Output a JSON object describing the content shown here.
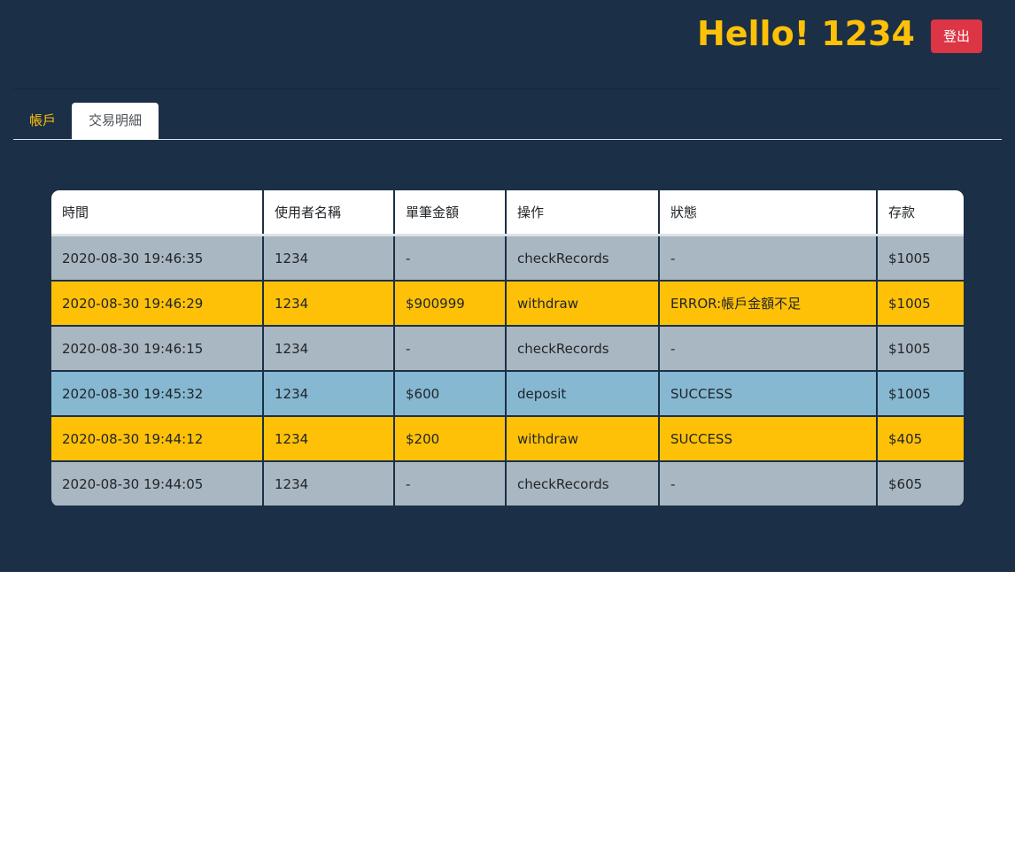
{
  "header": {
    "greeting": "Hello! 1234",
    "logout_label": "登出"
  },
  "tabs": [
    {
      "label": "帳戶",
      "active": false
    },
    {
      "label": "交易明細",
      "active": true
    }
  ],
  "table": {
    "columns": [
      "時間",
      "使用者名稱",
      "單筆金額",
      "操作",
      "狀態",
      "存款"
    ],
    "rows": [
      {
        "time": "2020-08-30 19:46:35",
        "user": "1234",
        "amount": "-",
        "action": "checkRecords",
        "status": "-",
        "balance": "$1005",
        "color": "gray"
      },
      {
        "time": "2020-08-30 19:46:29",
        "user": "1234",
        "amount": "$900999",
        "action": "withdraw",
        "status": "ERROR:帳戶金額不足",
        "balance": "$1005",
        "color": "yellow"
      },
      {
        "time": "2020-08-30 19:46:15",
        "user": "1234",
        "amount": "-",
        "action": "checkRecords",
        "status": "-",
        "balance": "$1005",
        "color": "gray"
      },
      {
        "time": "2020-08-30 19:45:32",
        "user": "1234",
        "amount": "$600",
        "action": "deposit",
        "status": "SUCCESS",
        "balance": "$1005",
        "color": "blue"
      },
      {
        "time": "2020-08-30 19:44:12",
        "user": "1234",
        "amount": "$200",
        "action": "withdraw",
        "status": "SUCCESS",
        "balance": "$405",
        "color": "yellow"
      },
      {
        "time": "2020-08-30 19:44:05",
        "user": "1234",
        "amount": "-",
        "action": "checkRecords",
        "status": "-",
        "balance": "$605",
        "color": "gray"
      }
    ]
  },
  "colors": {
    "background": "#1b2f46",
    "accent": "#ffc107",
    "danger": "#dc3545",
    "row_gray": "#a9b7c2",
    "row_yellow": "#ffc107",
    "row_blue": "#86b8d2"
  }
}
